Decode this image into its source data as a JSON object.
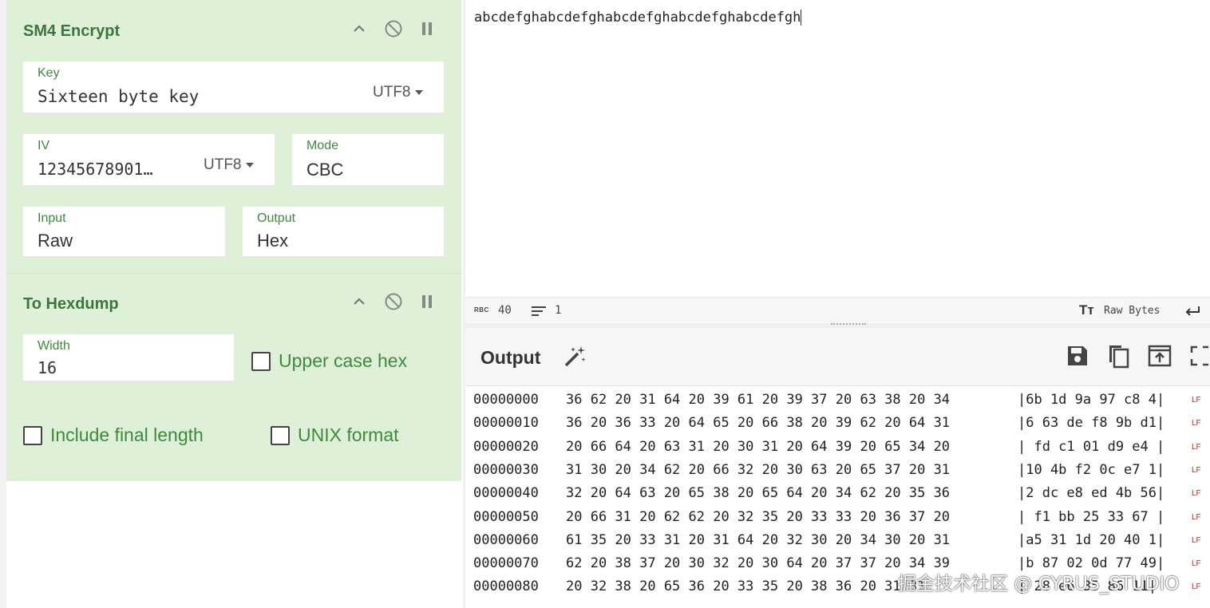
{
  "recipe": {
    "sm4": {
      "title": "SM4 Encrypt",
      "key_label": "Key",
      "key_value": "Sixteen byte key",
      "key_encoding": "UTF8",
      "iv_label": "IV",
      "iv_value": "12345678901…",
      "iv_encoding": "UTF8",
      "mode_label": "Mode",
      "mode_value": "CBC",
      "input_label": "Input",
      "input_value": "Raw",
      "output_label": "Output",
      "output_value": "Hex"
    },
    "hexdump": {
      "title": "To Hexdump",
      "width_label": "Width",
      "width_value": "16",
      "upper_case_label": "Upper case hex",
      "include_final_length_label": "Include final length",
      "unix_format_label": "UNIX format"
    }
  },
  "input": {
    "text": "abcdefghabcdefghabcdefghabcdefghabcdefgh"
  },
  "status": {
    "length": "40",
    "lines": "1",
    "raw_bytes_label": "Raw Bytes"
  },
  "output": {
    "title": "Output",
    "lf_label": "LF",
    "rows": [
      {
        "offset": "00000000",
        "hex": "36 62 20 31 64 20 39 61 20 39 37 20 63 38 20 34",
        "ascii": "|6b 1d 9a 97 c8 4|"
      },
      {
        "offset": "00000010",
        "hex": "36 20 36 33 20 64 65 20 66 38 20 39 62 20 64 31",
        "ascii": "|6 63 de f8 9b d1|"
      },
      {
        "offset": "00000020",
        "hex": "20 66 64 20 63 31 20 30 31 20 64 39 20 65 34 20",
        "ascii": "| fd c1 01 d9 e4 |"
      },
      {
        "offset": "00000030",
        "hex": "31 30 20 34 62 20 66 32 20 30 63 20 65 37 20 31",
        "ascii": "|10 4b f2 0c e7 1|"
      },
      {
        "offset": "00000040",
        "hex": "32 20 64 63 20 65 38 20 65 64 20 34 62 20 35 36",
        "ascii": "|2 dc e8 ed 4b 56|"
      },
      {
        "offset": "00000050",
        "hex": "20 66 31 20 62 62 20 32 35 20 33 33 20 36 37 20",
        "ascii": "| f1 bb 25 33 67 |"
      },
      {
        "offset": "00000060",
        "hex": "61 35 20 33 31 20 31 64 20 32 30 20 34 30 20 31",
        "ascii": "|a5 31 1d 20 40 1|"
      },
      {
        "offset": "00000070",
        "hex": "62 20 38 37 20 30 32 20 30 64 20 37 37 20 34 39",
        "ascii": "|b 87 02 0d 77 49|"
      },
      {
        "offset": "00000080",
        "hex": "20 32 38 20 65 36 20 33 35 20 38 36 20 31 31",
        "ascii": "| 28 e6 35 86 11|"
      }
    ]
  },
  "watermark": "掘金技术社区 @ CYRUS_STUDIO"
}
